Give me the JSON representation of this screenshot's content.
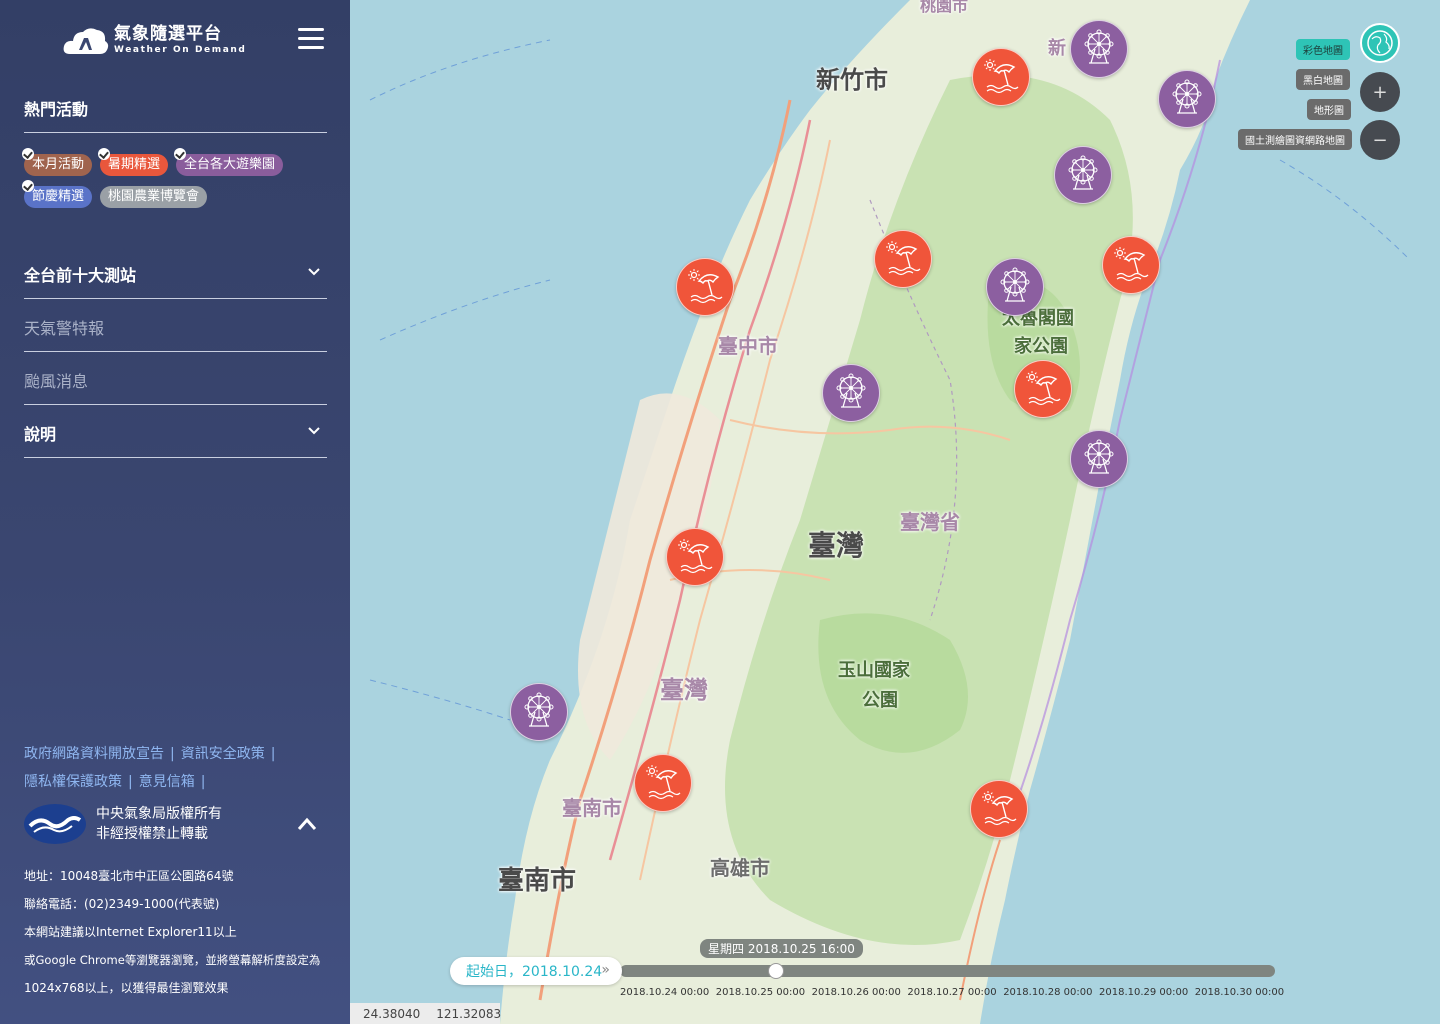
{
  "header": {
    "logo_title": "氣象隨選平台",
    "logo_subtitle": "Weather On Demand"
  },
  "sidebar": {
    "hot_activities_title": "熱門活動",
    "tags": [
      {
        "label": "本月活動",
        "checked": true,
        "color": "#a0644e"
      },
      {
        "label": "暑期精選",
        "checked": true,
        "color": "#e9573c"
      },
      {
        "label": "全台各大遊樂園",
        "checked": true,
        "color": "#8a5d9c"
      },
      {
        "label": "節慶精選",
        "checked": true,
        "color": "#5a73c8"
      },
      {
        "label": "桃園農業博覽會",
        "checked": false,
        "color": "#9aa0a6"
      }
    ],
    "sections": [
      {
        "label": "全台前十大測站",
        "expandable": true
      },
      {
        "label": "天氣警特報",
        "expandable": false
      },
      {
        "label": "颱風消息",
        "expandable": false
      },
      {
        "label": "說明",
        "expandable": true
      }
    ],
    "links_row1": [
      "政府網路資料開放宣告",
      "資訊安全政策"
    ],
    "links_row2": [
      "隱私權保護政策",
      "意見信箱"
    ],
    "copyright_line1": "中央氣象局版權所有",
    "copyright_line2": "非經授權禁止轉載",
    "info": [
      "地址：10048臺北市中正區公園路64號",
      "聯絡電話：(02)2349-1000(代表號)",
      "本網站建議以Internet Explorer11以上",
      "或Google Chrome等瀏覽器瀏覽，並將螢幕解析度設定為",
      "1024x768以上，以獲得最佳瀏覽效果"
    ]
  },
  "map": {
    "places": {
      "hsinchu": "新竹市",
      "xin": "新",
      "taichung": "臺中市",
      "taroko1": "太魯閣國",
      "taroko2": "家公園",
      "taiwan_province": "臺灣省",
      "taiwan_center": "臺灣",
      "yushan1": "玉山國家",
      "yushan2": "公園",
      "taiwan_sw": "臺灣",
      "tainan_faint": "臺南市",
      "tainan": "臺南市",
      "kaohsiung": "高雄市",
      "taoyuan_top": "桃園市"
    },
    "layers": [
      "彩色地圖",
      "黑白地圖",
      "地形圖",
      "國土測繪圖資網路地圖"
    ],
    "active_layer": "彩色地圖",
    "markers": [
      {
        "type": "beach",
        "icon": "beach-umbrella-icon"
      },
      {
        "type": "wheel",
        "icon": "ferris-wheel-icon"
      },
      {
        "type": "wheel",
        "icon": "ferris-wheel-icon"
      },
      {
        "type": "wheel",
        "icon": "ferris-wheel-icon"
      },
      {
        "type": "beach",
        "icon": "beach-umbrella-icon"
      },
      {
        "type": "beach",
        "icon": "beach-umbrella-icon"
      },
      {
        "type": "wheel",
        "icon": "ferris-wheel-icon"
      },
      {
        "type": "beach",
        "icon": "beach-umbrella-icon"
      },
      {
        "type": "wheel",
        "icon": "ferris-wheel-icon"
      },
      {
        "type": "beach",
        "icon": "beach-umbrella-icon"
      },
      {
        "type": "wheel",
        "icon": "ferris-wheel-icon"
      },
      {
        "type": "beach",
        "icon": "beach-umbrella-icon"
      },
      {
        "type": "wheel",
        "icon": "ferris-wheel-icon"
      },
      {
        "type": "beach",
        "icon": "beach-umbrella-icon"
      },
      {
        "type": "beach",
        "icon": "beach-umbrella-icon"
      }
    ],
    "zoom_in": "+",
    "zoom_out": "−"
  },
  "timeline": {
    "start_label": "起始日，2018.10.24",
    "start_arrows": "»",
    "current": "星期四 2018.10.25 16:00",
    "ticks": [
      "2018.10.24 00:00",
      "2018.10.25 00:00",
      "2018.10.26 00:00",
      "2018.10.27 00:00",
      "2018.10.28 00:00",
      "2018.10.29 00:00",
      "2018.10.30 00:00"
    ]
  },
  "coords": {
    "lat": "24.38040",
    "lng": "121.32083"
  },
  "colors": {
    "beach": "#f0553a",
    "wheel": "#8c5fa0",
    "accent": "#2ec4b6",
    "link": "#8fb6f0"
  }
}
